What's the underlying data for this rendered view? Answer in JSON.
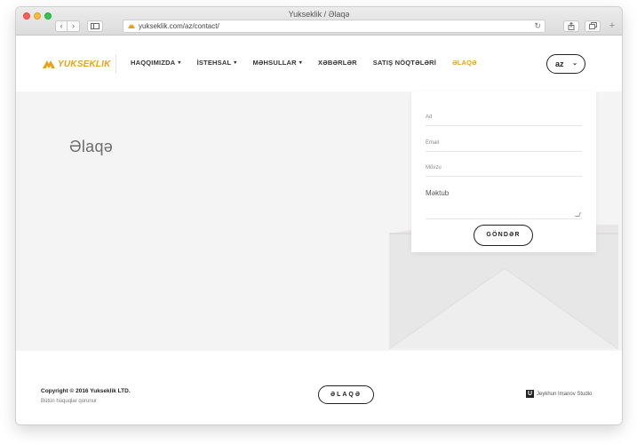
{
  "window": {
    "title": "Yukseklik / Əlaqə"
  },
  "browser": {
    "url": "yukseklik.com/az/contact/",
    "back_glyph": "‹",
    "forward_glyph": "›",
    "reload_glyph": "↻",
    "plus_glyph": "+"
  },
  "header": {
    "logo_text": "YUKSEKLIK",
    "menu": [
      {
        "label": "HAQQIMIZDA",
        "has_dropdown": true
      },
      {
        "label": "İSTEHSAL",
        "has_dropdown": true
      },
      {
        "label": "MƏHSULLAR",
        "has_dropdown": true
      },
      {
        "label": "XƏBƏRLƏR",
        "has_dropdown": false
      },
      {
        "label": "SATIŞ NÖQTƏLƏRİ",
        "has_dropdown": false
      },
      {
        "label": "ƏLAQƏ",
        "has_dropdown": false,
        "active": true
      }
    ],
    "language": {
      "selected": "az",
      "chevron": "⌄"
    }
  },
  "main": {
    "title": "Əlaqə",
    "form": {
      "ad_label": "Ad",
      "email_label": "Email",
      "movzu_label": "Mövzu",
      "mektub_label": "Məktub",
      "submit_label": "GÖNDƏR"
    }
  },
  "footer": {
    "copyright": "Copyright © 2016 Yukseklik LTD.",
    "rights": "Bütün hüquqlar qorunur",
    "contact_button": "ƏLAQƏ",
    "studio_mark": "U",
    "studio": "Jeykhun Imanov Studio"
  },
  "colors": {
    "accent": "#e8a21a",
    "hero_bg": "#f4f4f4",
    "envelope": "#e4e4e4"
  }
}
